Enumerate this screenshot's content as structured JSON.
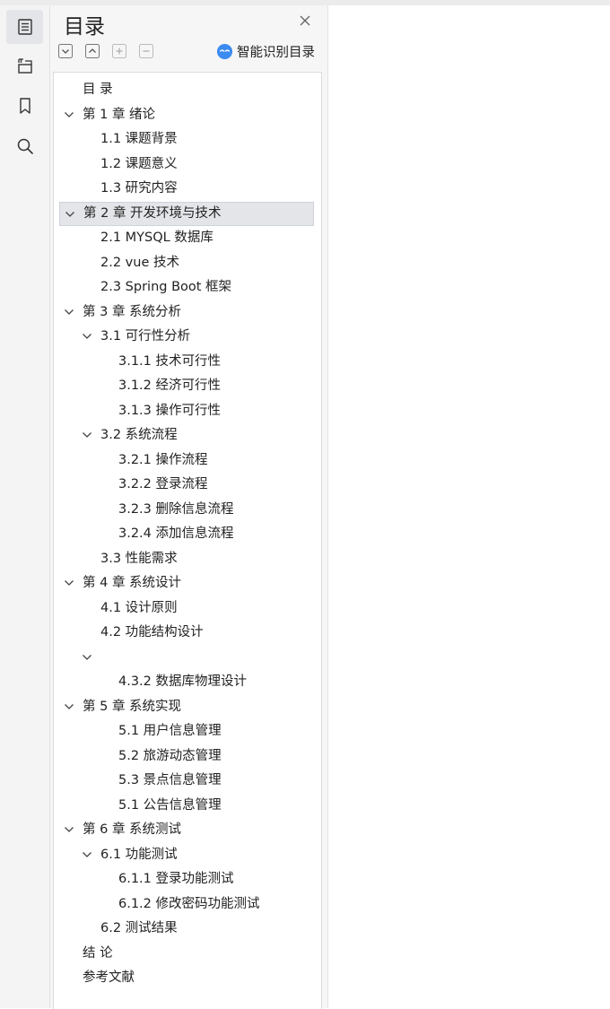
{
  "sidebar_rail": {
    "items": [
      {
        "icon": "outline-icon",
        "active": true
      },
      {
        "icon": "pages-icon",
        "active": false
      },
      {
        "icon": "bookmark-icon",
        "active": false
      },
      {
        "icon": "search-icon",
        "active": false
      }
    ]
  },
  "outline_panel": {
    "title": "目录",
    "smart_toc_label": "智能识别目录",
    "tools": [
      "collapse-all-icon",
      "expand-all-icon",
      "add-icon",
      "remove-icon"
    ]
  },
  "outline": [
    {
      "text": "目  录",
      "level": 0,
      "chevron": false
    },
    {
      "text": "第 1 章  绪论",
      "level": 0,
      "chevron": true
    },
    {
      "text": "1.1  课题背景",
      "level": 1,
      "chevron": false
    },
    {
      "text": "1.2  课题意义",
      "level": 1,
      "chevron": false
    },
    {
      "text": "1.3  研究内容",
      "level": 1,
      "chevron": false
    },
    {
      "text": "第 2 章  开发环境与技术",
      "level": 0,
      "chevron": true,
      "selected": true
    },
    {
      "text": "2.1 MYSQL 数据库",
      "level": 1,
      "chevron": false
    },
    {
      "text": "2.2 vue 技术",
      "level": 1,
      "chevron": false
    },
    {
      "text": "2.3 Spring Boot 框架",
      "level": 1,
      "chevron": false
    },
    {
      "text": "第 3 章  系统分析",
      "level": 0,
      "chevron": true
    },
    {
      "text": "3.1  可行性分析",
      "level": 1,
      "chevron": true
    },
    {
      "text": "3.1.1  技术可行性",
      "level": 2,
      "chevron": false
    },
    {
      "text": "3.1.2  经济可行性",
      "level": 2,
      "chevron": false
    },
    {
      "text": "3.1.3  操作可行性",
      "level": 2,
      "chevron": false
    },
    {
      "text": "3.2  系统流程",
      "level": 1,
      "chevron": true
    },
    {
      "text": "3.2.1  操作流程",
      "level": 2,
      "chevron": false
    },
    {
      "text": "3.2.2  登录流程",
      "level": 2,
      "chevron": false
    },
    {
      "text": "3.2.3  删除信息流程",
      "level": 2,
      "chevron": false
    },
    {
      "text": "3.2.4  添加信息流程",
      "level": 2,
      "chevron": false
    },
    {
      "text": "3.3  性能需求",
      "level": 1,
      "chevron": false
    },
    {
      "text": "第 4 章  系统设计",
      "level": 0,
      "chevron": true
    },
    {
      "text": "4.1  设计原则",
      "level": 1,
      "chevron": false
    },
    {
      "text": "4.2  功能结构设计",
      "level": 1,
      "chevron": false
    },
    {
      "text": "",
      "level": 1,
      "chevron": true
    },
    {
      "text": "4.3.2  数据库物理设计",
      "level": 2,
      "chevron": false
    },
    {
      "text": "第 5 章  系统实现",
      "level": 0,
      "chevron": true
    },
    {
      "text": "5.1 用户信息管理",
      "level": 2,
      "chevron": false
    },
    {
      "text": "5.2  旅游动态管理",
      "level": 2,
      "chevron": false
    },
    {
      "text": "5.3 景点信息管理",
      "level": 2,
      "chevron": false
    },
    {
      "text": "5.1 公告信息管理",
      "level": 2,
      "chevron": false
    },
    {
      "text": "第 6 章  系统测试",
      "level": 0,
      "chevron": true
    },
    {
      "text": "6.1  功能测试",
      "level": 1,
      "chevron": true
    },
    {
      "text": "6.1.1  登录功能测试",
      "level": 2,
      "chevron": false
    },
    {
      "text": "6.1.2  修改密码功能测试",
      "level": 2,
      "chevron": false
    },
    {
      "text": "6.2  测试结果",
      "level": 1,
      "chevron": false
    },
    {
      "text": "结  论",
      "level": 0,
      "chevron": false
    },
    {
      "text": "参考文献",
      "level": 0,
      "chevron": false
    }
  ]
}
